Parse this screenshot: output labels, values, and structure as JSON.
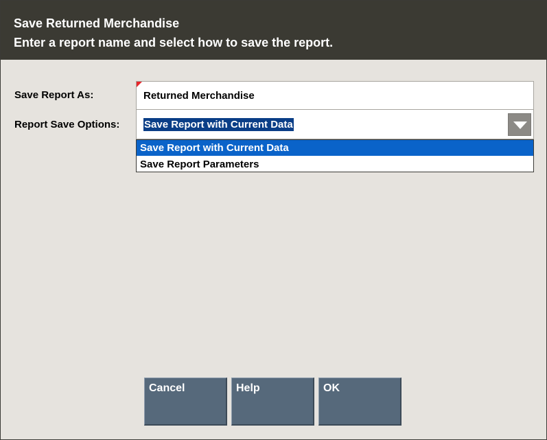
{
  "header": {
    "title": "Save Returned Merchandise",
    "subtitle": "Enter a report name and select how to save the report."
  },
  "form": {
    "report_name_label": "Save Report As:",
    "report_name_value": "Returned Merchandise",
    "save_options_label": "Report Save Options:",
    "save_options_selected": "Save Report with Current Data",
    "save_options": [
      "Save Report with Current Data",
      "Save Report Parameters"
    ]
  },
  "buttons": {
    "cancel": "Cancel",
    "help": "Help",
    "ok": "OK"
  },
  "colors": {
    "header_bg": "#3b3a33",
    "body_bg": "#e6e3de",
    "button_bg": "#56697b",
    "selection_bg": "#0a63c9",
    "required_marker": "#e8262a"
  },
  "icons": {
    "dropdown_arrow": "chevron-down-icon",
    "required_marker": "required-indicator-icon"
  }
}
